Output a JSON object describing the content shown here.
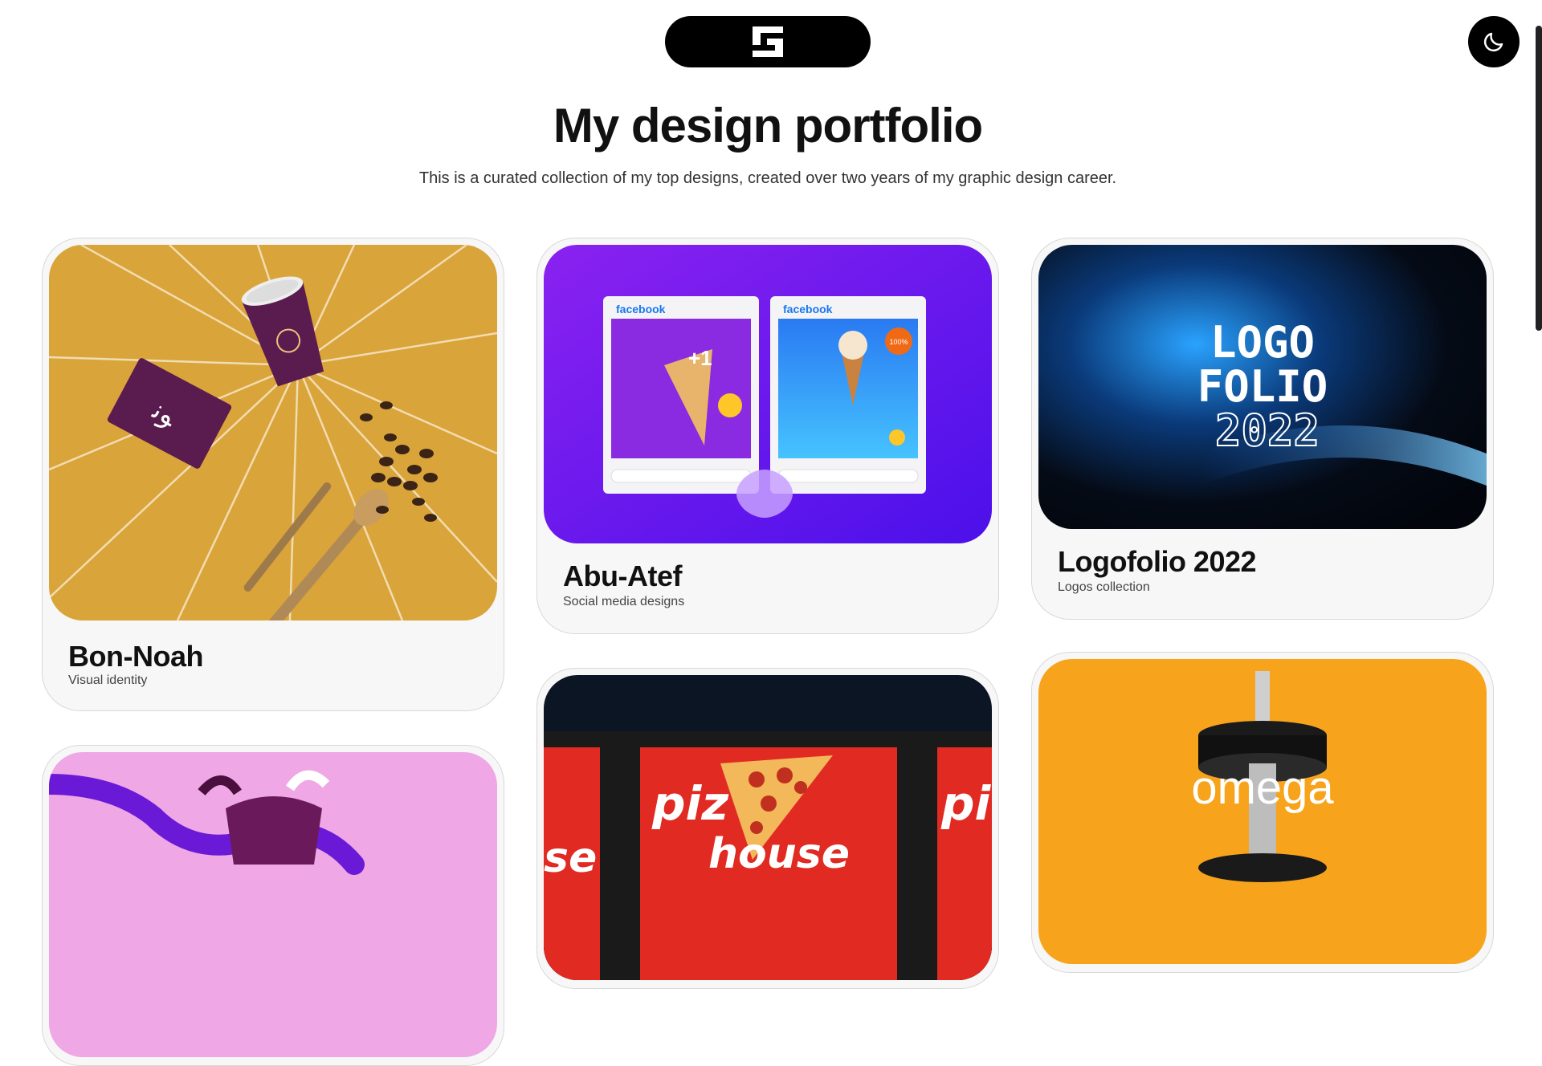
{
  "header": {
    "logo_icon": "brand-s-logo-icon",
    "theme_toggle_icon": "moon-icon"
  },
  "hero": {
    "title": "My design portfolio",
    "subtitle": "This is a curated collection of my top designs, created over two years of my graphic design career."
  },
  "projects": [
    {
      "title": "Bon-Noah",
      "subtitle": "Visual identity"
    },
    {
      "title": "Abu-Atef",
      "subtitle": "Social media designs",
      "mock_brand": "facebook",
      "plus_one": "+1",
      "badge_free": "100%"
    },
    {
      "title": "Logofolio 2022",
      "subtitle": "Logos collection",
      "art_lines": [
        "LOGO",
        "FOLIO",
        "2022"
      ]
    },
    {
      "title": "",
      "subtitle": ""
    },
    {
      "title": "",
      "subtitle": "",
      "art_words": [
        "piz",
        "house",
        "pi",
        "se"
      ]
    },
    {
      "title": "",
      "subtitle": "",
      "art_word": "omega"
    }
  ],
  "colors": {
    "bonnoah_bg": "#d9a43a",
    "bonnoah_purple": "#5a1b4f",
    "abuatef_bg": "#6a1bf3",
    "logofolio_bg": "#050b16",
    "logofolio_glow": "#2aa3ff",
    "pink_bg": "#efa7e6",
    "pizza_red": "#e02a22",
    "omega_bg": "#f7a41c"
  }
}
